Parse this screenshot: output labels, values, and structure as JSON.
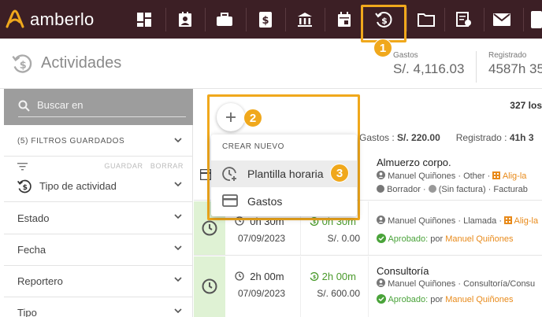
{
  "app": {
    "name": "amberlo"
  },
  "colors": {
    "topbar": "#3c1f25",
    "accent": "#f0a81c",
    "green": "#4aa33a",
    "orange": "#e88a1a"
  },
  "nav": {
    "icons": [
      "dashboard-icon",
      "contacts-icon",
      "briefcase-icon",
      "dollar-icon",
      "bank-icon",
      "calendar-icon",
      "activities-icon",
      "folder-icon",
      "certificate-icon",
      "mail-icon"
    ],
    "active": "activities-icon"
  },
  "callouts": {
    "one": "1",
    "two": "2",
    "three": "3"
  },
  "page": {
    "title": "Actividades",
    "gastos_label": "Gastos",
    "gastos_value": "S/. 4,116.03",
    "registrado_label": "Registrado",
    "registrado_value": "4587h 35"
  },
  "filters": {
    "search_placeholder": "Buscar en",
    "saved_label": "(5) FILTROS GUARDADOS",
    "guardar": "GUARDAR",
    "borrar": "BORRAR",
    "items": [
      {
        "label": "Tipo de actividad"
      },
      {
        "label": "Estado"
      },
      {
        "label": "Fecha"
      },
      {
        "label": "Reportero"
      },
      {
        "label": "Tipo"
      }
    ]
  },
  "list": {
    "total": "327 los",
    "summary_gastos_label": "Gastos :",
    "summary_gastos_value": "S/. 220.00",
    "summary_registrado_label": "Registrado :",
    "summary_registrado_value": "41h 3",
    "rows": [
      {
        "title": "Almuerzo corpo.",
        "line1_user": "Manuel Quiñones",
        "line1_type": " · Other ·",
        "line1_link": " Alig-la",
        "line2_a": "Borrador ·",
        "line2_b": " (Sin factura) · Facturab"
      },
      {
        "duration": "0h 30m",
        "date": "07/09/2023",
        "billed": "0h 30m",
        "amount": "S/. 0.00",
        "line1_user": "Manuel Quiñones",
        "line1_type": " · Llamada ·",
        "line1_link": " Alig-la",
        "status": "Aprobado:",
        "status_by": " por ",
        "status_user": "Manuel Quiñones"
      },
      {
        "duration": "2h 00m",
        "date": "07/09/2023",
        "billed": "2h 00m",
        "amount": "S/. 600.00",
        "title": "Consultoría",
        "line1_user": "Manuel Quiñones",
        "line1_type": " · Consultoría/Consu",
        "status": "Aprobado:",
        "status_by": " por ",
        "status_user": "Manuel Quiñones"
      }
    ]
  },
  "menu": {
    "header": "CREAR NUEVO",
    "items": [
      {
        "label": "Plantilla horaria",
        "icon": "clock-add-icon"
      },
      {
        "label": "Gastos",
        "icon": "card-icon"
      }
    ]
  }
}
